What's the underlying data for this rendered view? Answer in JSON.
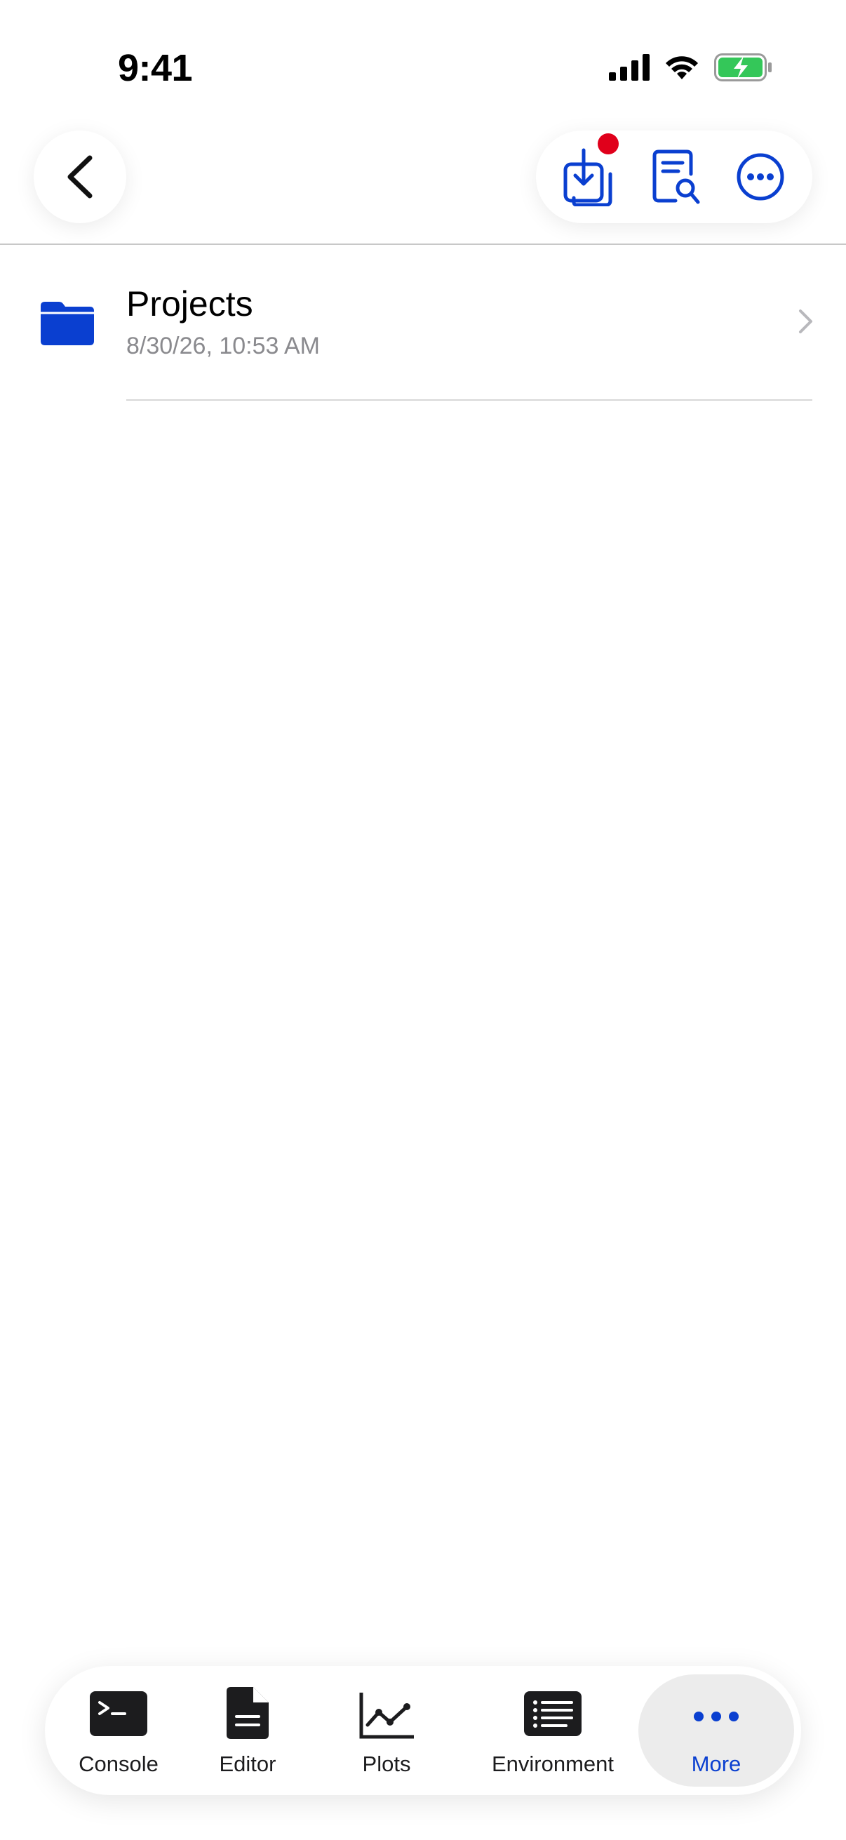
{
  "status_bar": {
    "time": "9:41"
  },
  "nav": {
    "back_icon": "chevron-left-icon",
    "actions": [
      "download-icon",
      "document-search-icon",
      "ellipsis-circle-icon"
    ]
  },
  "files": [
    {
      "icon": "folder-icon",
      "name": "Projects",
      "modified": "8/30/26, 10:53 AM"
    }
  ],
  "tab_bar": {
    "tabs": [
      {
        "label": "Console",
        "icon": "terminal-icon",
        "active": false
      },
      {
        "label": "Editor",
        "icon": "document-icon",
        "active": false
      },
      {
        "label": "Plots",
        "icon": "line-chart-icon",
        "active": false
      },
      {
        "label": "Environment",
        "icon": "list-icon",
        "active": false
      },
      {
        "label": "More",
        "icon": "ellipsis-icon",
        "active": true
      }
    ]
  },
  "colors": {
    "accent": "#0a3fd0",
    "badge": "#e0001b",
    "battery": "#34c759"
  }
}
